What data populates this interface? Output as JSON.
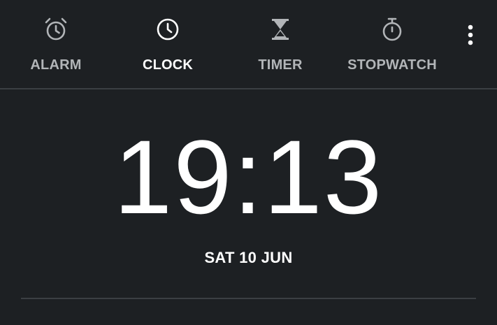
{
  "tabs": [
    {
      "label": "ALARM",
      "icon": "alarm-clock-icon",
      "active": false
    },
    {
      "label": "CLOCK",
      "icon": "clock-icon",
      "active": true
    },
    {
      "label": "TIMER",
      "icon": "hourglass-icon",
      "active": false
    },
    {
      "label": "STOPWATCH",
      "icon": "stopwatch-icon",
      "active": false
    }
  ],
  "overflow_menu": {
    "icon": "more-vertical-icon"
  },
  "clock": {
    "time": "19:13",
    "date": "SAT 10 JUN"
  },
  "colors": {
    "background": "#1d2023",
    "active_tab": "#ffffff",
    "inactive_tab": "#b2b5b8",
    "divider": "#3b3f43"
  }
}
